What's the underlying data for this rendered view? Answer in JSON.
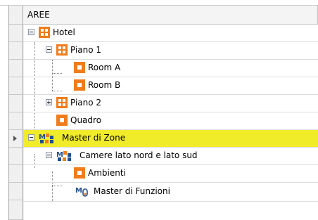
{
  "panel": {
    "column_header": "AREE"
  },
  "tree": [
    {
      "label": "Hotel",
      "icon": "building-grid-icon",
      "expander": "minus"
    },
    {
      "label": "Piano 1",
      "icon": "floor-grid-icon",
      "expander": "minus"
    },
    {
      "label": "Room A",
      "icon": "room-icon",
      "expander": "none"
    },
    {
      "label": "Room B",
      "icon": "room-icon",
      "expander": "none"
    },
    {
      "label": "Piano 2",
      "icon": "floor-grid-icon",
      "expander": "plus"
    },
    {
      "label": "Quadro",
      "icon": "room-icon",
      "expander": "none"
    },
    {
      "label": "Master di Zone",
      "icon": "zone-master-icon",
      "expander": "minus",
      "selected": true
    },
    {
      "label": "Camere lato nord e lato sud",
      "icon": "zone-master-icon",
      "expander": "minus"
    },
    {
      "label": "Ambienti",
      "icon": "room-icon",
      "expander": "none"
    },
    {
      "label": "Master di Funzioni",
      "icon": "function-master-icon",
      "expander": "none"
    }
  ],
  "colors": {
    "selection": "#f0ec2a",
    "icon_orange": "#f07c1c"
  }
}
